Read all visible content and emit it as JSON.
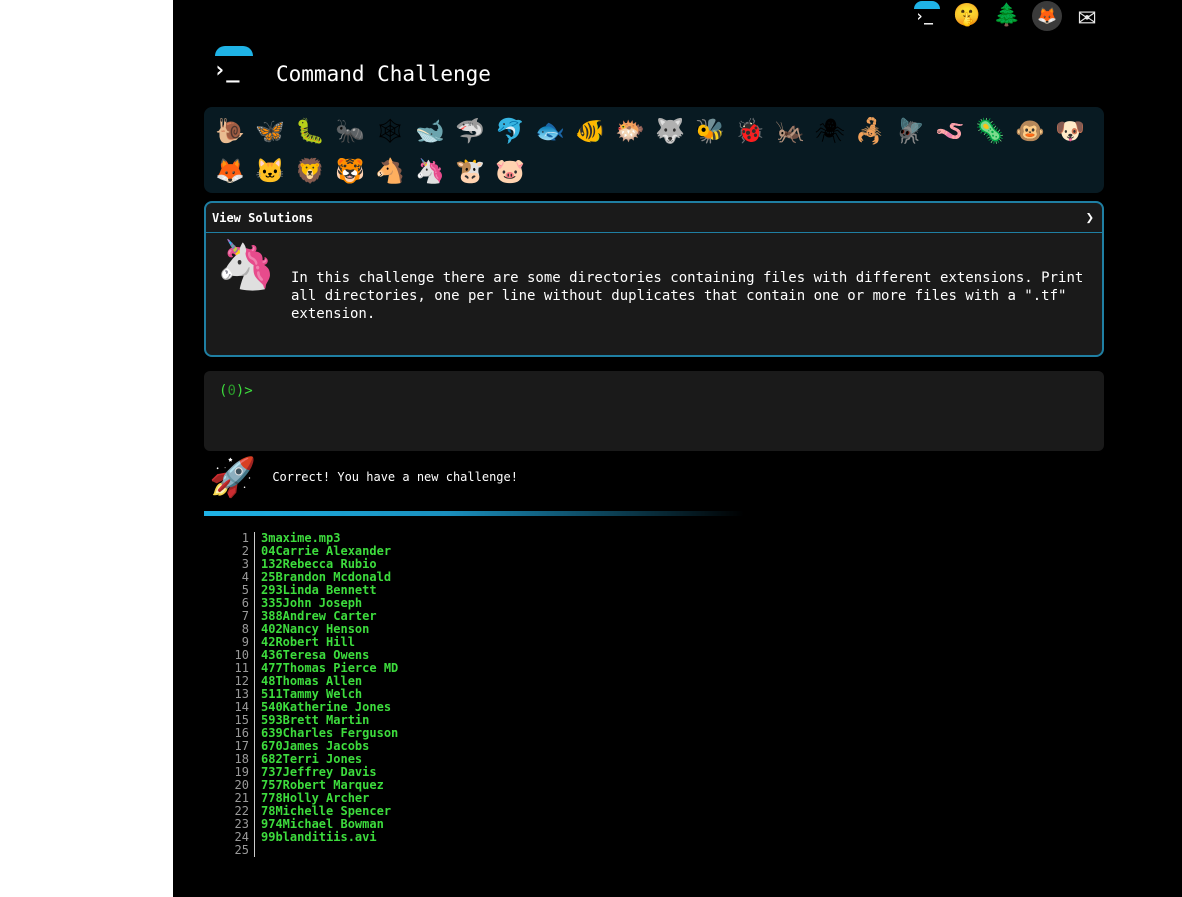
{
  "topbar": {
    "icons": [
      {
        "name": "terminal-icon",
        "glyph": "›_"
      },
      {
        "name": "shushing-face-icon",
        "glyph": "🤫"
      },
      {
        "name": "tree-icon",
        "glyph": "🌲"
      },
      {
        "name": "gitlab-icon",
        "glyph": "🦊"
      },
      {
        "name": "mail-icon",
        "glyph": "✉"
      }
    ]
  },
  "brand": {
    "title": "Command Challenge",
    "logo_glyph": "›_"
  },
  "animals": [
    {
      "name": "snail-icon",
      "glyph": "🐌"
    },
    {
      "name": "butterfly-icon",
      "glyph": "🦋"
    },
    {
      "name": "caterpillar-icon",
      "glyph": "🐛"
    },
    {
      "name": "ant-icon",
      "glyph": "🐜"
    },
    {
      "name": "spider-web-icon",
      "glyph": "🕸"
    },
    {
      "name": "whale-icon",
      "glyph": "🐋"
    },
    {
      "name": "shark-icon",
      "glyph": "🦈"
    },
    {
      "name": "dolphin-icon",
      "glyph": "🐬"
    },
    {
      "name": "fish-icon",
      "glyph": "🐟"
    },
    {
      "name": "tropical-fish-icon",
      "glyph": "🐠"
    },
    {
      "name": "blowfish-icon",
      "glyph": "🐡"
    },
    {
      "name": "wolf-icon",
      "glyph": "🐺"
    },
    {
      "name": "bee-icon",
      "glyph": "🐝"
    },
    {
      "name": "ladybug-icon",
      "glyph": "🐞"
    },
    {
      "name": "cricket-icon",
      "glyph": "🦗"
    },
    {
      "name": "spider-icon",
      "glyph": "🕷"
    },
    {
      "name": "scorpion-icon",
      "glyph": "🦂"
    },
    {
      "name": "fly-icon",
      "glyph": "🪰"
    },
    {
      "name": "worm-icon",
      "glyph": "🪱"
    },
    {
      "name": "microbe-icon",
      "glyph": "🦠"
    },
    {
      "name": "monkey-icon",
      "glyph": "🐵"
    },
    {
      "name": "dog-icon",
      "glyph": "🐶"
    },
    {
      "name": "fox-icon",
      "glyph": "🦊"
    },
    {
      "name": "cat-icon",
      "glyph": "🐱"
    },
    {
      "name": "lion-icon",
      "glyph": "🦁"
    },
    {
      "name": "tiger-icon",
      "glyph": "🐯"
    },
    {
      "name": "horse-icon",
      "glyph": "🐴"
    },
    {
      "name": "unicorn-icon",
      "glyph": "🦄"
    },
    {
      "name": "cow-icon",
      "glyph": "🐮"
    },
    {
      "name": "pig-icon",
      "glyph": "🐷"
    }
  ],
  "solutions": {
    "header": "View Solutions",
    "chevron": "❯",
    "unicorn_glyph": "🦄",
    "description": "In this challenge there are some directories containing files with different extensions. Print all directories, one per line without duplicates that contain one or more files with a \".tf\" extension."
  },
  "terminal": {
    "prompt_open": "(",
    "prompt_count": "0",
    "prompt_close": ")>"
  },
  "result": {
    "rocket_glyph": "🚀",
    "message": "Correct! You have a new challenge!"
  },
  "output": {
    "lines": [
      {
        "n": "1",
        "t": "3maxime.mp3"
      },
      {
        "n": "2",
        "t": "04Carrie Alexander"
      },
      {
        "n": "3",
        "t": "132Rebecca Rubio"
      },
      {
        "n": "4",
        "t": "25Brandon Mcdonald"
      },
      {
        "n": "5",
        "t": "293Linda Bennett"
      },
      {
        "n": "6",
        "t": "335John Joseph"
      },
      {
        "n": "7",
        "t": "388Andrew Carter"
      },
      {
        "n": "8",
        "t": "402Nancy Henson"
      },
      {
        "n": "9",
        "t": "42Robert Hill"
      },
      {
        "n": "10",
        "t": "436Teresa Owens"
      },
      {
        "n": "11",
        "t": "477Thomas Pierce MD"
      },
      {
        "n": "12",
        "t": "48Thomas Allen"
      },
      {
        "n": "13",
        "t": "511Tammy Welch"
      },
      {
        "n": "14",
        "t": "540Katherine Jones"
      },
      {
        "n": "15",
        "t": "593Brett Martin"
      },
      {
        "n": "16",
        "t": "639Charles Ferguson"
      },
      {
        "n": "17",
        "t": "670James Jacobs"
      },
      {
        "n": "18",
        "t": "682Terri Jones"
      },
      {
        "n": "19",
        "t": "737Jeffrey Davis"
      },
      {
        "n": "20",
        "t": "757Robert Marquez"
      },
      {
        "n": "21",
        "t": "778Holly Archer"
      },
      {
        "n": "22",
        "t": "78Michelle Spencer"
      },
      {
        "n": "23",
        "t": "974Michael Bowman"
      },
      {
        "n": "24",
        "t": "99blanditiis.avi"
      },
      {
        "n": "25",
        "t": ""
      }
    ]
  },
  "colors": {
    "accent": "#1fb3e6",
    "prompt_green": "#3ddc3d",
    "panel_border": "#1f7fa3"
  }
}
